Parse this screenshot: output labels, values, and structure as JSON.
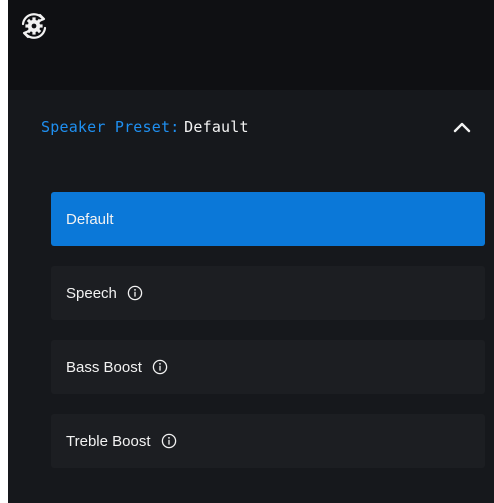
{
  "header": {
    "icons": {
      "sync": "sync-settings-gear-icon"
    }
  },
  "preset": {
    "label": "Speaker Preset:",
    "value": "Default",
    "expanded": true,
    "toggle_icon": "chevron-up-icon"
  },
  "options": [
    {
      "label": "Default",
      "selected": true,
      "info": false
    },
    {
      "label": "Speech",
      "selected": false,
      "info": true
    },
    {
      "label": "Bass Boost",
      "selected": false,
      "info": true
    },
    {
      "label": "Treble Boost",
      "selected": false,
      "info": true
    }
  ],
  "colors": {
    "accent": "#1f8ff0",
    "selected_bg": "#0b78d8",
    "panel_bg": "#16181c",
    "option_bg": "#1c1e22",
    "text": "#f2f2f2"
  }
}
